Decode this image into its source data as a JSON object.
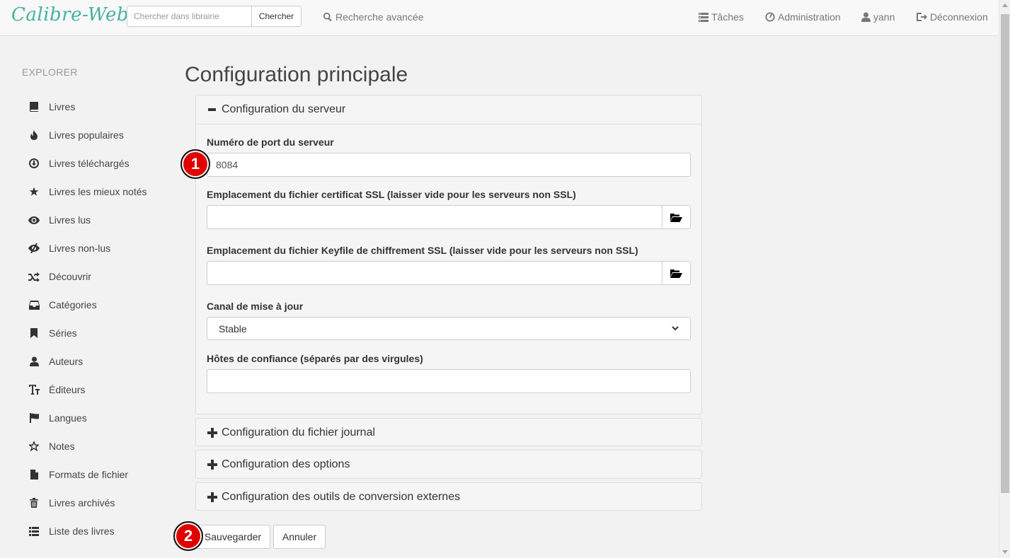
{
  "navbar": {
    "brand": "Calibre-Web",
    "search_placeholder": "Chercher dans librairie",
    "search_button": "Chercher",
    "advanced_search": "Recherche avancée",
    "tasks": "Tâches",
    "admin": "Administration",
    "user": "yann",
    "logout": "Déconnexion"
  },
  "sidebar": {
    "title": "EXPLORER",
    "items": [
      {
        "label": "Livres",
        "icon": "book-icon"
      },
      {
        "label": "Livres populaires",
        "icon": "fire-icon"
      },
      {
        "label": "Livres téléchargés",
        "icon": "download-icon"
      },
      {
        "label": "Livres les mieux notés",
        "icon": "star-icon"
      },
      {
        "label": "Livres lus",
        "icon": "eye-icon"
      },
      {
        "label": "Livres non-lus",
        "icon": "eye-slash-icon"
      },
      {
        "label": "Découvrir",
        "icon": "shuffle-icon"
      },
      {
        "label": "Catégories",
        "icon": "inbox-icon"
      },
      {
        "label": "Séries",
        "icon": "bookmark-icon"
      },
      {
        "label": "Auteurs",
        "icon": "user-icon"
      },
      {
        "label": "Éditeurs",
        "icon": "text-size-icon"
      },
      {
        "label": "Langues",
        "icon": "flag-icon"
      },
      {
        "label": "Notes",
        "icon": "star-empty-icon"
      },
      {
        "label": "Formats de fichier",
        "icon": "file-icon"
      },
      {
        "label": "Livres archivés",
        "icon": "trash-icon"
      },
      {
        "label": "Liste des livres",
        "icon": "list-icon"
      }
    ]
  },
  "main": {
    "title": "Configuration principale",
    "server_panel": {
      "heading": "Configuration du serveur",
      "port_label": "Numéro de port du serveur",
      "port_value": "8084",
      "ssl_cert_label": "Emplacement du fichier certificat SSL (laisser vide pour les serveurs non SSL)",
      "ssl_key_label": "Emplacement du fichier Keyfile de chiffrement SSL (laisser vide pour les serveurs non SSL)",
      "channel_label": "Canal de mise à jour",
      "channel_value": "Stable",
      "trusted_hosts_label": "Hôtes de confiance (séparés par des virgules)"
    },
    "collapsed_panels": [
      "Configuration du fichier journal",
      "Configuration des options",
      "Configuration des outils de conversion externes"
    ],
    "save_button": "Sauvegarder",
    "cancel_button": "Annuler"
  },
  "markers": [
    "1",
    "2"
  ],
  "colors": {
    "brand": "#45b29d",
    "marker": "#e00000"
  }
}
